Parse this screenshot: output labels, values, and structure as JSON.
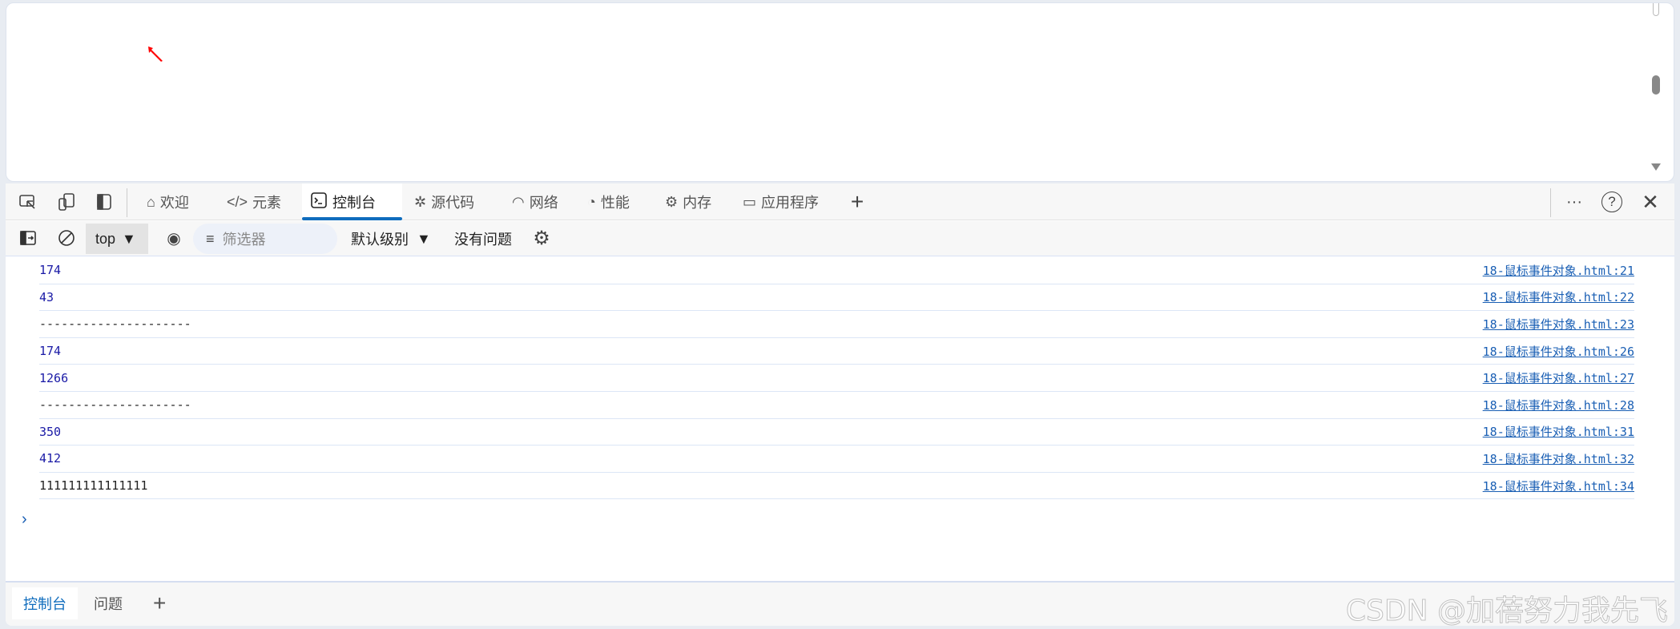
{
  "devtools": {
    "tabs": [
      {
        "label": "欢迎",
        "icon": "home-icon"
      },
      {
        "label": "元素",
        "icon": "code-icon"
      },
      {
        "label": "控制台",
        "icon": "console-icon",
        "active": true
      },
      {
        "label": "源代码",
        "icon": "bug-icon"
      },
      {
        "label": "网络",
        "icon": "wifi-icon"
      },
      {
        "label": "性能",
        "icon": "gauge-icon"
      },
      {
        "label": "内存",
        "icon": "chip-icon"
      },
      {
        "label": "应用程序",
        "icon": "window-icon"
      }
    ],
    "more": "···",
    "help": "?"
  },
  "toolbar": {
    "context": "top",
    "filter_placeholder": "筛选器",
    "level": "默认级别",
    "issues": "没有问题"
  },
  "console": {
    "rows": [
      {
        "value": "174",
        "source": "18-鼠标事件对象.html:21",
        "type": "number"
      },
      {
        "value": "43",
        "source": "18-鼠标事件对象.html:22",
        "type": "number"
      },
      {
        "value": "---------------------",
        "source": "18-鼠标事件对象.html:23",
        "type": "string"
      },
      {
        "value": "174",
        "source": "18-鼠标事件对象.html:26",
        "type": "number"
      },
      {
        "value": "1266",
        "source": "18-鼠标事件对象.html:27",
        "type": "number"
      },
      {
        "value": "---------------------",
        "source": "18-鼠标事件对象.html:28",
        "type": "string"
      },
      {
        "value": "350",
        "source": "18-鼠标事件对象.html:31",
        "type": "number"
      },
      {
        "value": "412",
        "source": "18-鼠标事件对象.html:32",
        "type": "number"
      },
      {
        "value": "111111111111111",
        "source": "18-鼠标事件对象.html:34",
        "type": "string"
      }
    ],
    "prompt": "›"
  },
  "drawer": {
    "tabs": [
      "控制台",
      "问题"
    ],
    "add": "+"
  },
  "watermark": "CSDN @加蓓努力我先飞",
  "colors": {
    "accent": "#0f6cbd",
    "number": "#1a1aa6",
    "link": "#1a5fb4",
    "cursor": "#ff0000"
  }
}
